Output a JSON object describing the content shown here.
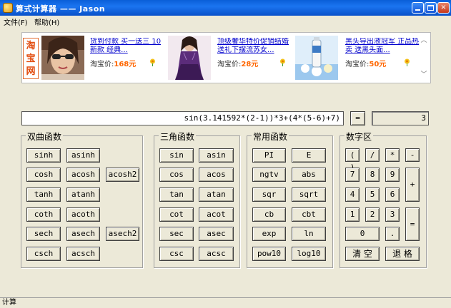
{
  "window": {
    "title": "算式计算器 —— Jason",
    "min_glyph": "_",
    "max_glyph": "□",
    "close_glyph": "×"
  },
  "menu": [
    {
      "label": "文件(F)"
    },
    {
      "label": "帮助(H)"
    }
  ],
  "ads": {
    "logo_text": "淘宝网",
    "price_prefix": "淘宝价:",
    "items": [
      {
        "title": "货到付款 买一送三 10新款 经典...",
        "price": "168元"
      },
      {
        "title": "顶级奢华特价促销结婚送礼下摆流苏女...",
        "price": "28元"
      },
      {
        "title": "黑头导出液冠军 正品热卖 送黑头面...",
        "price": "50元"
      }
    ],
    "scroll_up": "︿",
    "scroll_down": "﹀"
  },
  "calculator": {
    "expression": "sin(3.141592*(2-1))*3+(4*(5-6)+7)",
    "equals_label": "=",
    "result": "3"
  },
  "groups": {
    "hyperbolic": {
      "title": "双曲函数",
      "rows": [
        [
          "sinh",
          "asinh"
        ],
        [
          "cosh",
          "acosh",
          "acosh2"
        ],
        [
          "tanh",
          "atanh"
        ],
        [
          "coth",
          "acoth"
        ],
        [
          "sech",
          "asech",
          "asech2"
        ],
        [
          "csch",
          "acsch"
        ]
      ]
    },
    "trig": {
      "title": "三角函数",
      "rows": [
        [
          "sin",
          "asin"
        ],
        [
          "cos",
          "acos"
        ],
        [
          "tan",
          "atan"
        ],
        [
          "cot",
          "acot"
        ],
        [
          "sec",
          "asec"
        ],
        [
          "csc",
          "acsc"
        ]
      ]
    },
    "common": {
      "title": "常用函数",
      "rows": [
        [
          "PI",
          "E"
        ],
        [
          "ngtv",
          "abs"
        ],
        [
          "sqr",
          "sqrt"
        ],
        [
          "cb",
          "cbt"
        ],
        [
          "exp",
          "ln"
        ],
        [
          "pow10",
          "log10"
        ]
      ]
    },
    "digits": {
      "title": "数字区",
      "keys": [
        "( )",
        "/",
        "*",
        "-",
        "7",
        "8",
        "9",
        "+",
        "4",
        "5",
        "6",
        "1",
        "2",
        "3",
        "=",
        "0",
        ".",
        "清 空",
        "退 格"
      ]
    }
  },
  "status": {
    "text": "计算"
  }
}
